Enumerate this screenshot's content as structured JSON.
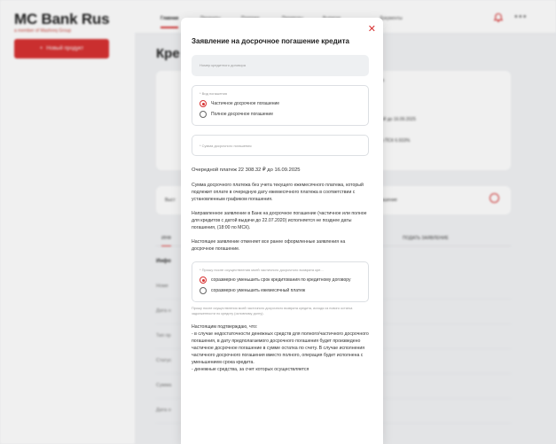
{
  "sidebar": {
    "brand": "MC Bank Rus",
    "brand_sub": "a member of Mashreq Group",
    "new_product_label": "Новый продукт"
  },
  "topbar": {
    "tabs": [
      "Главная",
      "Продукты",
      "Платежи",
      "Переводы",
      "Выписки",
      "Документы"
    ]
  },
  "page": {
    "title": "Кре",
    "card_a": {
      "line1": "та",
      "line2": "2 ₽ до 16.09.2025",
      "line3": "%     ПСК 6.933%"
    },
    "card_b": {
      "left": "Выст",
      "right": "ашение"
    },
    "tabs": [
      "ИНФ",
      "ПОДАТЬ ЗАЯВЛЕНИЕ"
    ],
    "info_head": "Инфо",
    "info_rows": [
      "Номе",
      "Дата н",
      "Тип пр",
      "Статус",
      "Сумма",
      "Дата о"
    ]
  },
  "modal": {
    "title": "Заявление на досрочное погашение кредита",
    "contract_label": "Номер кредитного договора",
    "repayment_type": {
      "legend": "* Вид погашения",
      "options": [
        {
          "label": "Частичное досрочное погашение",
          "selected": true
        },
        {
          "label": "Полное досрочное погашение",
          "selected": false
        }
      ]
    },
    "amount_placeholder": "* Сумма досрочного погашения",
    "next_payment": "Очередной платеж 22 308.32 ₽ до 16.09.2025",
    "para1": "Сумма досрочного платежа без учета текущего ежемесячного платежа, который подлежит оплате в очередную дату ежемесячного платежа в соответствии с установленным графиком погашения.",
    "para2": "Направленное заявление в Банк на досрочное погашение (частичное или полное для кредитов с датой выдачи до 22.07.2020) исполняется не позднее даты погашения, (18:00 по МСК).",
    "para3": "Настоящее заявление отменяет все ранее оформленные заявления на досрочное погашение.",
    "after_partial": {
      "legend": "* Прошу после осуществления моей частичного досрочного возврата кре...",
      "options": [
        {
          "label": "соразмерно уменьшить срок кредитования по кредитному договору",
          "selected": true
        },
        {
          "label": "соразмерно уменьшить ежемесячный платеж",
          "selected": false
        }
      ]
    },
    "after_note": "Прошу после осуществления моей частичного досрочного возврата кредита, исходя из нового остатка задолженности по кредиту (основному долгу).",
    "confirm_head": "Настоящим подтверждаю, что:",
    "confirm_text": "- в случае недостаточности денежных средств для полного/частичного досрочного погашения, в дату предполагаемого досрочного погашения будет произведено частичное досрочное погашение в сумме остатка по счету. В случае исполнения частичного досрочного погашения вместо полного, операция будет исполнена с уменьшением срока кредита.",
    "confirm_text2": "- денежные средства, за счет которых осуществляется"
  },
  "colors": {
    "accent": "#d73232"
  }
}
